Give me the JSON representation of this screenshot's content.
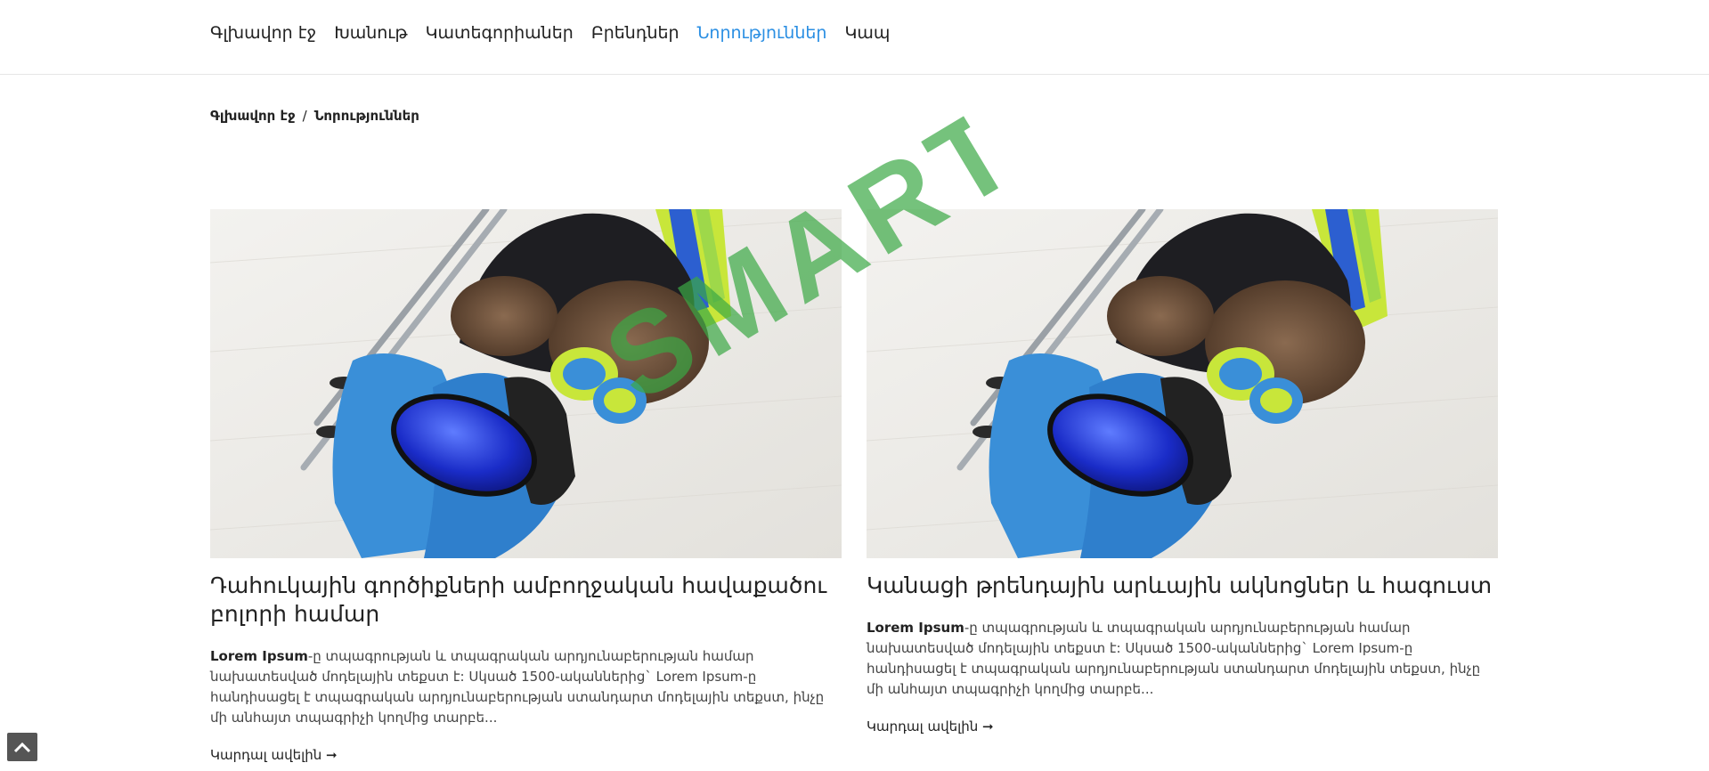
{
  "nav": {
    "items": [
      {
        "label": "Գլխավոր էջ"
      },
      {
        "label": "Խանութ"
      },
      {
        "label": "Կատեգորիաներ"
      },
      {
        "label": "Բրենդներ"
      },
      {
        "label": "Նորություններ"
      },
      {
        "label": "Կապ"
      }
    ],
    "active_index": 4
  },
  "breadcrumb": {
    "home": "Գլխավոր էջ",
    "separator": "/",
    "current": "Նորություններ"
  },
  "articles": [
    {
      "title": "Դահուկային գործիքների ամբողջական հավաքածու բոլորի համար",
      "excerpt_bold": "Lorem Ipsum",
      "excerpt": "-ը տպագրության և տպագրական արդյունաբերության համար նախատեսված մոդելային տեքստ է: Սկսած 1500-ականներից` Lorem Ipsum-ը հանդիսացել է տպագրական արդյունաբերության ստանդարտ մոդելային տեքստ, ինչը մի անհայտ տպագրիչի կողմից տարբե...",
      "read_more": "Կարդալ ավելին ➞"
    },
    {
      "title": "Կանացի թրենդային արևային ակնոցներ և հագուստ",
      "excerpt_bold": "Lorem Ipsum",
      "excerpt": "-ը տպագրության և տպագրական արդյունաբերության համար նախատեսված մոդելային տեքստ է: Սկսած 1500-ականներից` Lorem Ipsum-ը հանդիսացել է տպագրական արդյունաբերության ստանդարտ մոդելային տեքստ, ինչը մի անհայտ տպագրիչի կողմից տարբե...",
      "read_more": "Կարդալ ավելին ➞"
    }
  ],
  "watermark": {
    "text": "SMART",
    "color": "#3aa845"
  },
  "colors": {
    "accent": "#2b8fe3",
    "glove": "#3a8fd8",
    "goggle": "#1a2cc8",
    "ski": "#c8e63a",
    "jacket": "#1e1e22",
    "fur": "#6a4e3a",
    "floor": "#eceae6"
  },
  "icons": {
    "scroll_top": "chevron-up-icon",
    "read_more_arrow": "arrow-right-icon"
  }
}
